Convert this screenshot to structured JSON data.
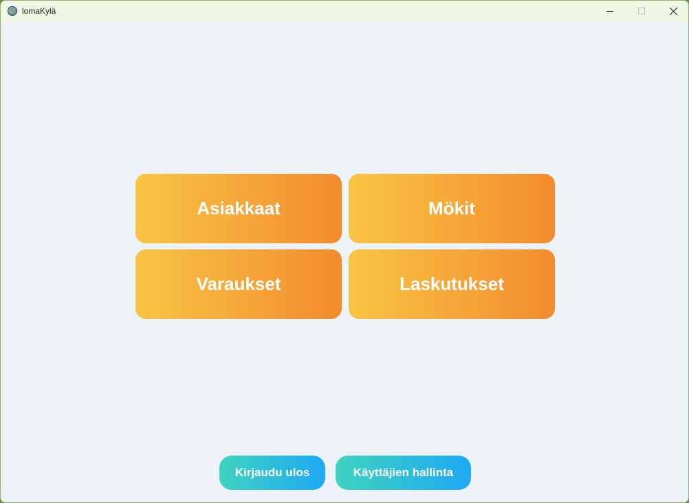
{
  "window": {
    "title": "lomaKylä",
    "icon": "globe-icon",
    "controls": [
      "minimize-icon",
      "maximize-icon",
      "close-icon"
    ]
  },
  "main_menu": {
    "tiles": [
      {
        "label": "Asiakkaat"
      },
      {
        "label": "Mökit"
      },
      {
        "label": "Varaukset"
      },
      {
        "label": "Laskutukset"
      }
    ],
    "tile_gradient": [
      "#f8c443",
      "#f38b2d"
    ]
  },
  "footer": {
    "logout_label": "Kirjaudu ulos",
    "user_management_label": "Käyttäjien hallinta",
    "button_gradient": [
      "#3ed3c0",
      "#1ea9f5"
    ]
  },
  "colors": {
    "background": "#edf2f6",
    "titlebar": "#eff6e4",
    "text_on_buttons": "#ffffff"
  }
}
